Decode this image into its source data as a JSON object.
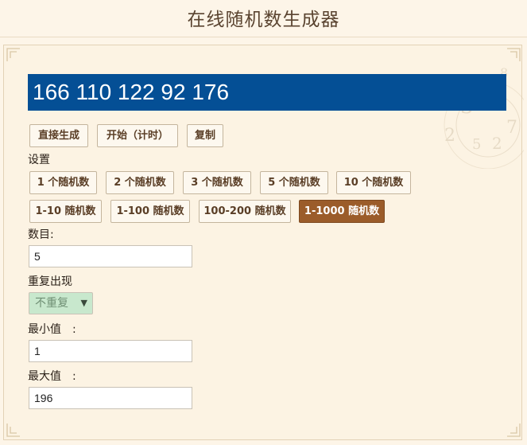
{
  "page": {
    "title": "在线随机数生成器"
  },
  "result": {
    "display": "166 110 122 92 176"
  },
  "actions": {
    "generate": "直接生成",
    "start_timed": "开始（计时）",
    "copy": "复制"
  },
  "settings": {
    "label": "设置",
    "presets_row1": [
      "1 个随机数",
      "2 个随机数",
      "3 个随机数",
      "5 个随机数",
      "10 个随机数"
    ],
    "presets_row2": [
      "1-10 随机数",
      "1-100 随机数",
      "100-200 随机数",
      "1-1000 随机数"
    ],
    "active_preset": "1-1000 随机数"
  },
  "form": {
    "count_label": "数目:",
    "count_value": "5",
    "repeat_label": "重复出现",
    "repeat_value": "不重复",
    "min_label": "最小值　:",
    "min_value": "1",
    "max_label": "最大值　:",
    "max_value": "196"
  },
  "colors": {
    "display_bg": "#044f95",
    "active_button": "#9b5c2a",
    "page_bg": "#fdf5e8",
    "select_bg": "#c8e8cd"
  }
}
